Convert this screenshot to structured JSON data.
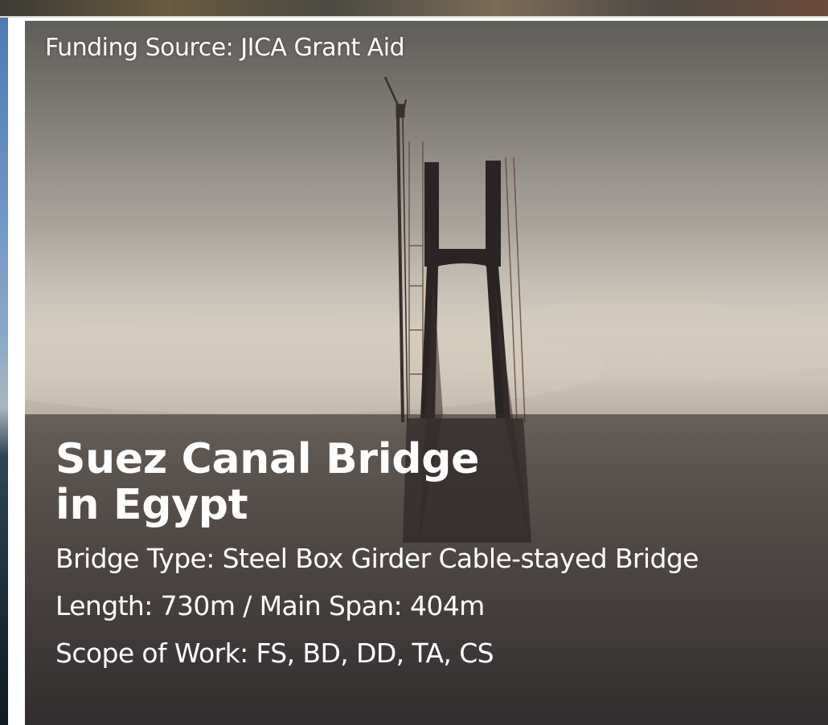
{
  "card": {
    "funding_source": "Funding Source: JICA Grant Aid",
    "title_line1": "Suez Canal Bridge",
    "title_line2": "in Egypt",
    "details": [
      "Bridge Type: Steel Box Girder Cable-stayed Bridge",
      "Length: 730m / Main Span: 404m",
      "Scope of Work: FS, BD, DD, TA, CS"
    ]
  },
  "colors": {
    "text": "#ffffff",
    "caption_overlay": "#322c2a",
    "sky_haze": "#c9c0b2",
    "tower": "#2a2424"
  },
  "photo": {
    "subject": "bridge-tower-in-fog-photo"
  }
}
